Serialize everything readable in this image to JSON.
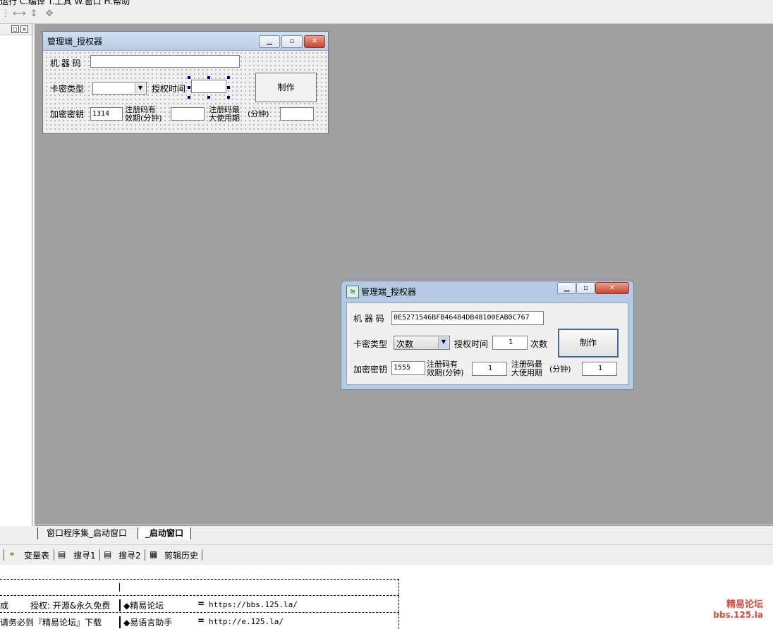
{
  "menubar": {
    "text": "运行  C.编译  T.工具  W.窗口  H.帮助"
  },
  "toolbar": {
    "icons": [
      "align-horizontal-icon",
      "align-vertical-icon",
      "center-icon"
    ]
  },
  "design_form": {
    "title": "管理端_授权器",
    "machine_code_label": "机 器 码",
    "machine_code_value": "",
    "card_type_label": "卡密类型",
    "auth_time_label": "授权时间",
    "make_button": "制作",
    "encrypt_key_label": "加密密钥",
    "encrypt_key_value": "1314",
    "reg_valid_label_1": "注册码有",
    "reg_valid_label_2": "效期(分钟)",
    "reg_max_label_1": "注册码最",
    "reg_max_label_2": "大使用期",
    "minutes_label": "(分钟)"
  },
  "runtime_form": {
    "title": "管理端_授权器",
    "machine_code_label": "机 器 码",
    "machine_code_value": "0E5271546BFB46484DB48100EAB0C767",
    "card_type_label": "卡密类型",
    "card_type_value": "次数",
    "auth_time_label": "授权时间",
    "auth_time_value": "1",
    "auth_unit": "次数",
    "make_button": "制作",
    "encrypt_key_label": "加密密钥",
    "encrypt_key_value": "1555",
    "reg_valid_label_1": "注册码有",
    "reg_valid_label_2": "效期(分钟)",
    "reg_valid_value": "1",
    "reg_max_label_1": "注册码最",
    "reg_max_label_2": "大使用期",
    "minutes_label": "(分钟)",
    "reg_max_value": "1"
  },
  "editor_tabs": [
    "窗口程序集_启动窗口",
    "_启动窗口"
  ],
  "bottom_tabs": [
    "变量表",
    "搜寻1",
    "搜寻2",
    "剪辑历史"
  ],
  "output": {
    "row1_col1": "成",
    "row1_col2": "授权: 开源&永久免费",
    "row1_col3": "◆精易论坛",
    "row1_eq": "=",
    "row1_url": "https://bbs.125.la/",
    "row2_col1": "请务必到『精易论坛』下载",
    "row2_col3": "◆易语言助手",
    "row2_eq": "=",
    "row2_url": "http://e.125.la/"
  },
  "watermark": {
    "line1": "精易论坛",
    "line2": "bbs.125.la"
  }
}
